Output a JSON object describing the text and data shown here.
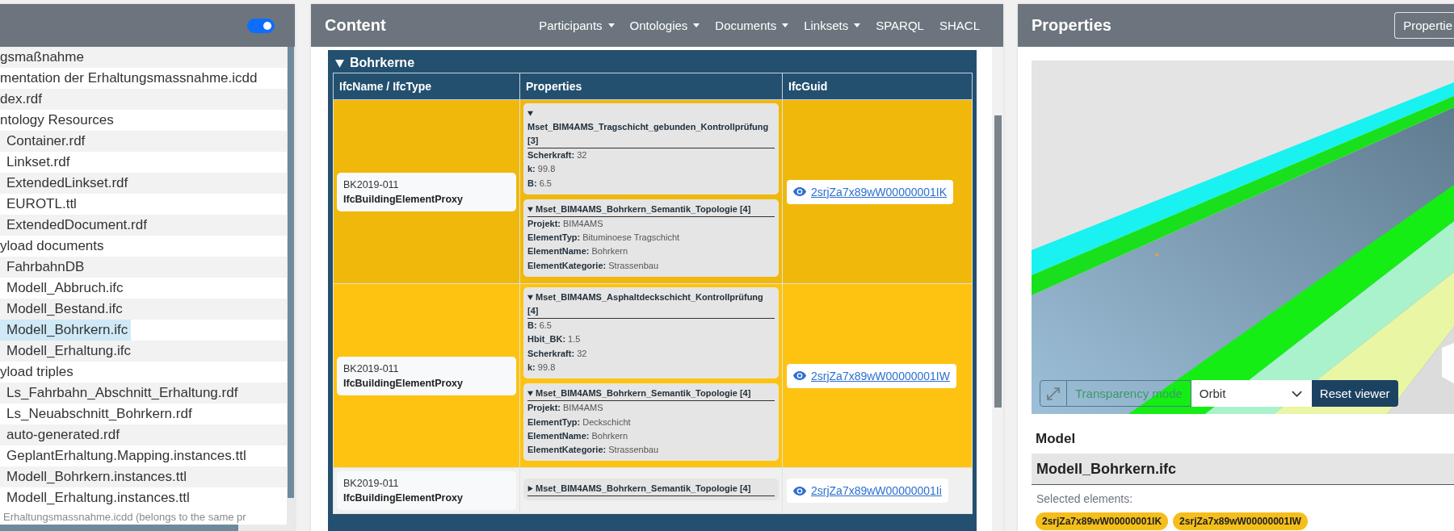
{
  "sidebar": {
    "toggle": {
      "on": true
    },
    "tree": [
      {
        "label": "gsmaßnahme",
        "selected": false
      },
      {
        "label": "mentation der Erhaltungsmassnahme.icdd",
        "selected": false
      },
      {
        "label": "dex.rdf",
        "selected": false
      },
      {
        "label": "ntology Resources",
        "selected": false,
        "children": [
          {
            "label": "Container.rdf",
            "selected": false
          },
          {
            "label": "Linkset.rdf",
            "selected": false
          },
          {
            "label": "ExtendedLinkset.rdf",
            "selected": false
          },
          {
            "label": "EUROTL.ttl",
            "selected": false
          },
          {
            "label": "ExtendedDocument.rdf",
            "selected": false
          }
        ]
      },
      {
        "label": "yload documents",
        "selected": false,
        "children": [
          {
            "label": "FahrbahnDB",
            "selected": false
          },
          {
            "label": "Modell_Abbruch.ifc",
            "selected": false
          },
          {
            "label": "Modell_Bestand.ifc",
            "selected": false
          },
          {
            "label": "Modell_Bohrkern.ifc",
            "selected": true
          },
          {
            "label": "Modell_Erhaltung.ifc",
            "selected": false
          }
        ]
      },
      {
        "label": "yload triples",
        "selected": false,
        "children": [
          {
            "label": "Ls_Fahrbahn_Abschnitt_Erhaltung.rdf",
            "selected": false
          },
          {
            "label": "Ls_Neuabschnitt_Bohrkern.rdf",
            "selected": false
          },
          {
            "label": "auto-generated.rdf",
            "selected": false
          },
          {
            "label": "GeplantErhaltung.Mapping.instances.ttl",
            "selected": false
          },
          {
            "label": "Modell_Bohrkern.instances.ttl",
            "selected": false
          },
          {
            "label": "Modell_Erhaltung.instances.ttl",
            "selected": false
          }
        ]
      }
    ],
    "note": "Erhaltungsmassnahme.icdd (belongs to the same pr"
  },
  "content": {
    "title": "Content",
    "nav": [
      {
        "label": "Participants",
        "dropdown": true
      },
      {
        "label": "Ontologies",
        "dropdown": true
      },
      {
        "label": "Documents",
        "dropdown": true
      },
      {
        "label": "Linksets",
        "dropdown": true
      },
      {
        "label": "SPARQL",
        "dropdown": false
      },
      {
        "label": "SHACL",
        "dropdown": false
      }
    ],
    "section": {
      "title": "Bohrkerne",
      "expanded": true,
      "columns": [
        "IfcName / IfcType",
        "Properties",
        "IfcGuid"
      ],
      "rows": [
        {
          "name": "BK2019-011",
          "type": "IfcBuildingElementProxy",
          "selected": true,
          "property_sets": [
            {
              "title": "Mset_BIM4AMS_Tragschicht_gebunden_Kontrollprüfung [3]",
              "expanded": true,
              "properties": [
                "**Scherkraft:** 32",
                "**k:** 99.8",
                "**B:** 6.5"
              ]
            },
            {
              "title": "Mset_BIM4AMS_Bohrkern_Semantik_Topologie [4]",
              "expanded": true,
              "properties": [
                "**Projekt:** BIM4AMS",
                "**ElementTyp:** Bituminoese Tragschicht",
                "**ElementName:** Bohrkern",
                "**ElementKategorie:** Strassenbau"
              ]
            }
          ],
          "guid": "2srjZa7x89wW00000001IK"
        },
        {
          "name": "BK2019-011",
          "type": "IfcBuildingElementProxy",
          "selected": true,
          "property_sets": [
            {
              "title": "Mset_BIM4AMS_Asphaltdeckschicht_Kontrollprüfung [4]",
              "expanded": true,
              "properties": [
                "**B:** 6.5",
                "**Hbit_BK:** 1.5",
                "**Scherkraft:** 32",
                "**k:** 99.8"
              ]
            },
            {
              "title": "Mset_BIM4AMS_Bohrkern_Semantik_Topologie [4]",
              "expanded": true,
              "properties": [
                "**Projekt:** BIM4AMS",
                "**ElementTyp:** Deckschicht",
                "**ElementName:** Bohrkern",
                "**ElementKategorie:** Strassenbau"
              ]
            }
          ],
          "guid": "2srjZa7x89wW00000001IW"
        },
        {
          "name": "BK2019-011",
          "type": "IfcBuildingElementProxy",
          "selected": false,
          "property_sets": [
            {
              "title": "Mset_BIM4AMS_Bohrkern_Semantik_Topologie [4]",
              "expanded": false
            }
          ],
          "guid": "2srjZa7x89wW00000001Ii"
        }
      ]
    }
  },
  "properties_panel": {
    "title": "Properties",
    "button": "Propertie",
    "viewer": {
      "transparency_button": "Transparency mode",
      "mode_select": "Orbit",
      "reset_button": "Reset viewer"
    },
    "model_heading": "Model",
    "model_name": "Modell_Bohrkern.ifc",
    "selected_label": "Selected elements:",
    "selected_elements": [
      "2srjZa7x89wW00000001IK",
      "2srjZa7x89wW00000001IW"
    ]
  }
}
